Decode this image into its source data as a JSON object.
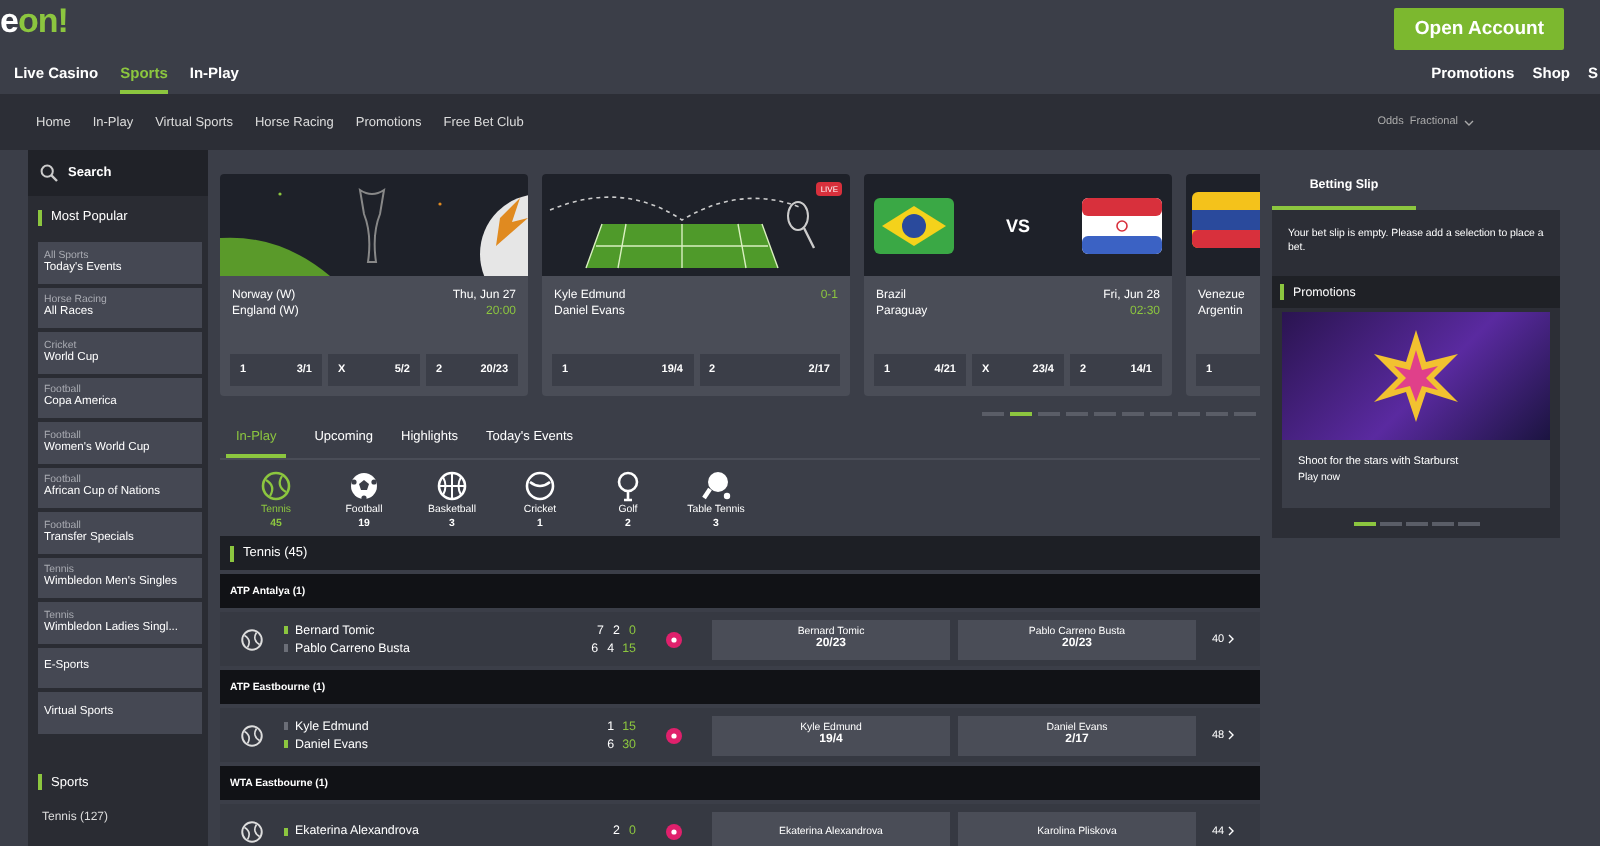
{
  "header": {
    "logo": "eon!",
    "open_account_button": "Open Account"
  },
  "main_nav": {
    "items": [
      {
        "label": "Live Casino",
        "selected": false
      },
      {
        "label": "Sports",
        "selected": true
      },
      {
        "label": "In-Play",
        "selected": false
      }
    ],
    "right_links": [
      "Promotions",
      "Shop",
      "S"
    ]
  },
  "sub_nav": {
    "items": [
      "Home",
      "In-Play",
      "Virtual Sports",
      "Horse Racing",
      "Promotions",
      "Free Bet Club"
    ],
    "odds_label": "Odds",
    "odds_value": "Fractional"
  },
  "sidebar": {
    "search_placeholder": "Search",
    "most_popular_title": "Most Popular",
    "items": [
      {
        "category": "All Sports",
        "title": "Today's Events"
      },
      {
        "category": "Horse Racing",
        "title": "All Races"
      },
      {
        "category": "Cricket",
        "title": "World Cup"
      },
      {
        "category": "Football",
        "title": "Copa America"
      },
      {
        "category": "Football",
        "title": "Women's World Cup"
      },
      {
        "category": "Football",
        "title": "African Cup of Nations"
      },
      {
        "category": "Football",
        "title": "Transfer Specials"
      },
      {
        "category": "Tennis",
        "title": "Wimbledon Men's Singles"
      },
      {
        "category": "Tennis",
        "title": "Wimbledon Ladies Singl..."
      },
      {
        "title": "E-Sports"
      },
      {
        "title": "Virtual Sports"
      }
    ],
    "sports_title": "Sports",
    "sports": [
      "Tennis (127)"
    ]
  },
  "featured": {
    "cards": [
      {
        "kind": "football",
        "teams": [
          "Norway (W)",
          "England (W)"
        ],
        "date": "Thu, Jun 27",
        "time": "20:00",
        "odds": [
          {
            "label": "1",
            "price": "3/1"
          },
          {
            "label": "X",
            "price": "5/2"
          },
          {
            "label": "2",
            "price": "20/23"
          }
        ]
      },
      {
        "kind": "tennis",
        "live_badge": "LIVE",
        "teams": [
          "Kyle Edmund",
          "Daniel Evans"
        ],
        "score": "0-1",
        "odds": [
          {
            "label": "1",
            "price": "19/4"
          },
          {
            "label": "2",
            "price": "2/17"
          }
        ]
      },
      {
        "kind": "versus",
        "vs_label": "VS",
        "teams": [
          "Brazil",
          "Paraguay"
        ],
        "date": "Fri, Jun 28",
        "time": "02:30",
        "odds": [
          {
            "label": "1",
            "price": "4/21"
          },
          {
            "label": "X",
            "price": "23/4"
          },
          {
            "label": "2",
            "price": "14/1"
          }
        ]
      },
      {
        "kind": "flag",
        "teams": [
          "Venezue",
          "Argentin"
        ],
        "odds": [
          {
            "label": "1"
          }
        ]
      }
    ],
    "indicators": [
      {
        "selected": false
      },
      {
        "selected": true
      },
      {
        "selected": false
      },
      {
        "selected": false
      },
      {
        "selected": false
      },
      {
        "selected": false
      },
      {
        "selected": false
      },
      {
        "selected": false
      },
      {
        "selected": false
      },
      {
        "selected": false
      }
    ]
  },
  "in_play": {
    "tabs": [
      {
        "label": "In-Play",
        "selected": true
      },
      {
        "label": "Upcoming",
        "selected": false
      },
      {
        "label": "Highlights",
        "selected": false
      },
      {
        "label": "Today's Events",
        "selected": false
      }
    ],
    "sports": [
      {
        "kind": "tennis",
        "label": "Tennis",
        "count": "45",
        "selected": true
      },
      {
        "kind": "football",
        "label": "Football",
        "count": "19",
        "selected": false
      },
      {
        "kind": "basketball",
        "label": "Basketball",
        "count": "3",
        "selected": false
      },
      {
        "kind": "cricket",
        "label": "Cricket",
        "count": "1",
        "selected": false
      },
      {
        "kind": "golf",
        "label": "Golf",
        "count": "2",
        "selected": false
      },
      {
        "kind": "table_tennis",
        "label": "Table Tennis",
        "count": "3",
        "selected": false
      }
    ],
    "section": {
      "title": "Tennis (45)",
      "competitions": [
        {
          "name": "ATP Antalya (1)",
          "match": {
            "players": [
              {
                "name": "Bernard Tomic",
                "serving": true,
                "scores": [
                  "7",
                  "2",
                  "0"
                ]
              },
              {
                "name": "Pablo Carreno Busta",
                "serving": false,
                "scores": [
                  "6",
                  "4",
                  "15"
                ]
              }
            ],
            "odds": [
              {
                "name": "Bernard Tomic",
                "price": "20/23"
              },
              {
                "name": "Pablo Carreno Busta",
                "price": "20/23"
              }
            ],
            "more": "40"
          }
        },
        {
          "name": "ATP Eastbourne (1)",
          "match": {
            "players": [
              {
                "name": "Kyle Edmund",
                "serving": false,
                "scores": [
                  "1",
                  "15"
                ]
              },
              {
                "name": "Daniel Evans",
                "serving": true,
                "scores": [
                  "6",
                  "30"
                ]
              }
            ],
            "odds": [
              {
                "name": "Kyle Edmund",
                "price": "19/4"
              },
              {
                "name": "Daniel Evans",
                "price": "2/17"
              }
            ],
            "more": "48"
          }
        },
        {
          "name": "WTA Eastbourne (1)",
          "match": {
            "players": [
              {
                "name": "Ekaterina Alexandrova",
                "serving": true,
                "scores": [
                  "2",
                  "0"
                ]
              }
            ],
            "odds": [
              {
                "name": "Ekaterina Alexandrova"
              },
              {
                "name": "Karolina Pliskova"
              }
            ],
            "more": "44"
          }
        }
      ]
    }
  },
  "betting_slip": {
    "tab": {
      "label": "Betting Slip",
      "selected": true
    },
    "message": "Your bet slip is empty. Please add a selection to place a bet.",
    "promotions_title": "Promotions",
    "promo": {
      "title": "Shoot for the stars with Starburst",
      "link": "Play now",
      "indicators": [
        {
          "selected": true
        },
        {
          "selected": false
        },
        {
          "selected": false
        },
        {
          "selected": false
        },
        {
          "selected": false
        }
      ]
    }
  }
}
